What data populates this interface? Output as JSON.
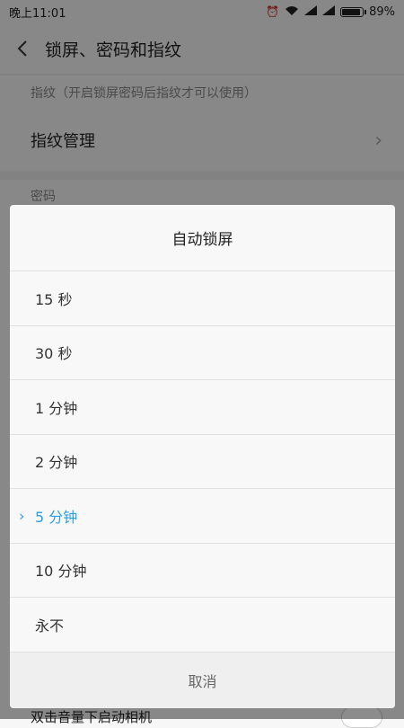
{
  "status": {
    "time": "晚上11:01",
    "battery": "89%",
    "battery_level": 0.89
  },
  "header": {
    "title": "锁屏、密码和指纹"
  },
  "fingerprint": {
    "section": "指纹（开启锁屏密码后指纹才可以使用）",
    "manage": "指纹管理"
  },
  "password": {
    "section": "密码"
  },
  "bottom": {
    "label": "双击音量下启动相机"
  },
  "dialog": {
    "title": "自动锁屏",
    "options": [
      "15 秒",
      "30 秒",
      "1 分钟",
      "2 分钟",
      "5 分钟",
      "10 分钟",
      "永不"
    ],
    "selected_index": 4,
    "cancel": "取消"
  },
  "colors": {
    "accent": "#2a9fe0"
  }
}
